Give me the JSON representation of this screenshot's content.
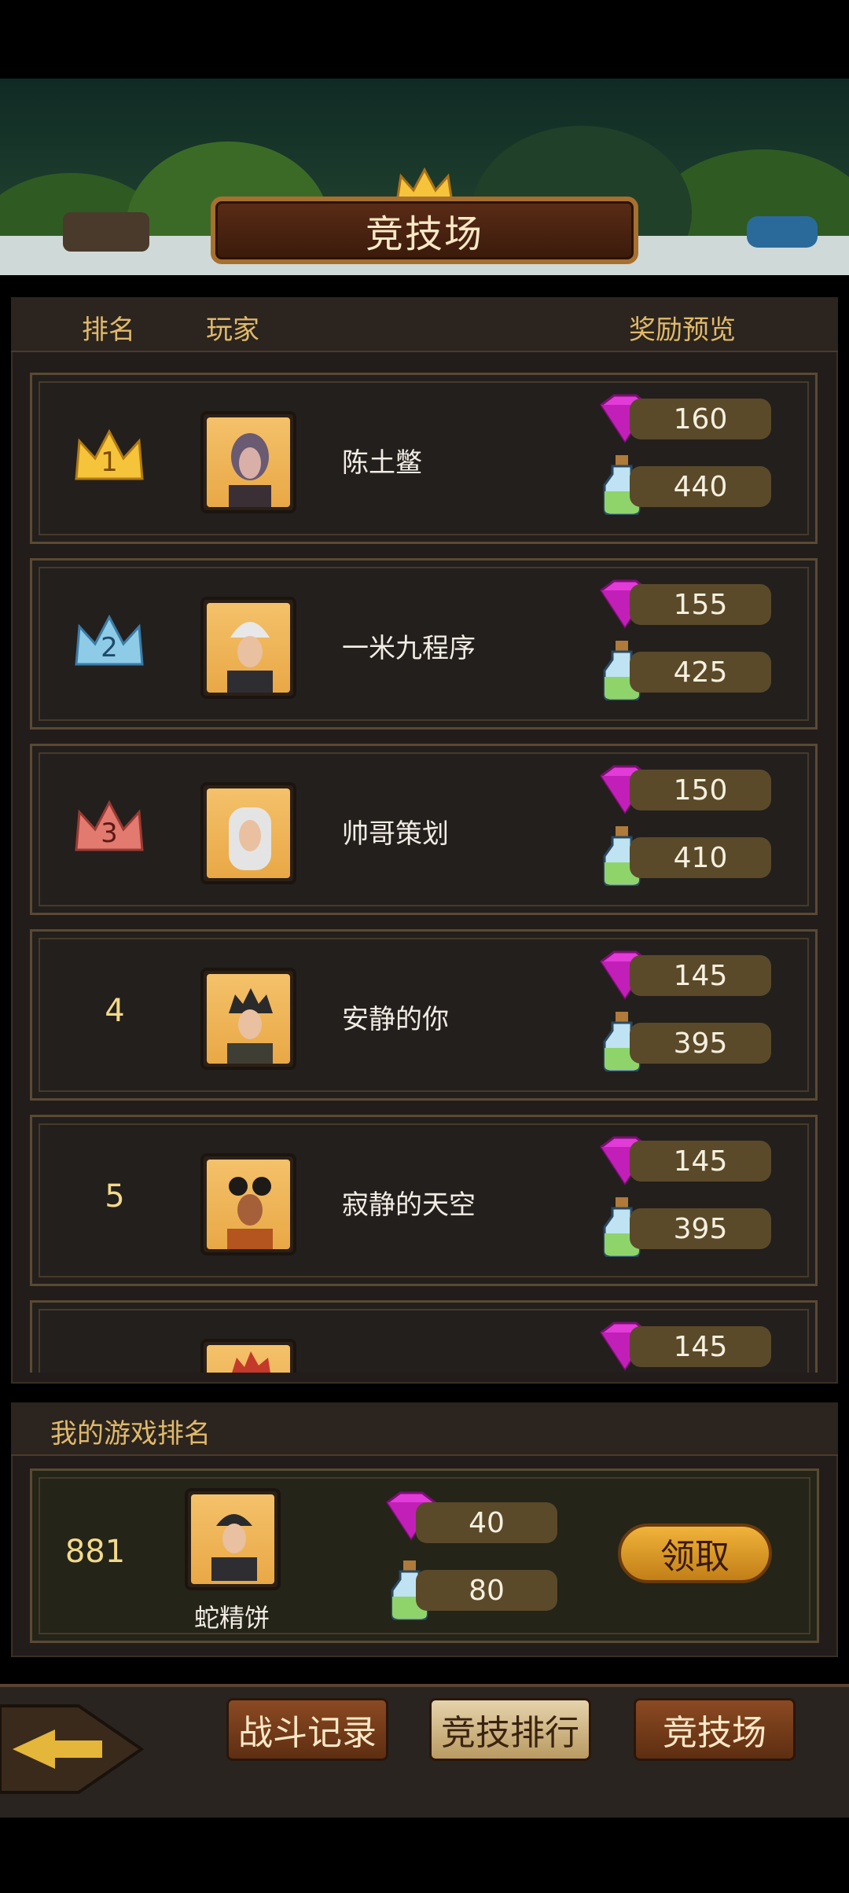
{
  "title": "竞技场",
  "header": {
    "rank_label": "排名",
    "player_label": "玩家",
    "reward_label": "奖励预览"
  },
  "leaderboard": [
    {
      "rank": "1",
      "name": "陈土鳖",
      "gems": "160",
      "potions": "440",
      "crown": "gold"
    },
    {
      "rank": "2",
      "name": "一米九程序",
      "gems": "155",
      "potions": "425",
      "crown": "blue"
    },
    {
      "rank": "3",
      "name": "帅哥策划",
      "gems": "150",
      "potions": "410",
      "crown": "red"
    },
    {
      "rank": "4",
      "name": "安静的你",
      "gems": "145",
      "potions": "395"
    },
    {
      "rank": "5",
      "name": "寂静的天空",
      "gems": "145",
      "potions": "395"
    },
    {
      "rank": "",
      "name": "",
      "gems": "145",
      "potions": ""
    }
  ],
  "my_rank": {
    "section_label": "我的游戏排名",
    "rank": "881",
    "name": "蛇精饼",
    "gems": "40",
    "potions": "80",
    "claim_label": "领取"
  },
  "tabs": [
    {
      "label": "战斗记录",
      "active": false
    },
    {
      "label": "竞技排行",
      "active": true
    },
    {
      "label": "竞技场",
      "active": false
    }
  ],
  "colors": {
    "accent_gold": "#e0b969",
    "pill": "#5a4a2a",
    "gem": "#e23bd8",
    "panel": "#221d1a"
  },
  "icons": [
    "gem-icon",
    "potion-icon",
    "crown-icon",
    "back-arrow-icon"
  ]
}
